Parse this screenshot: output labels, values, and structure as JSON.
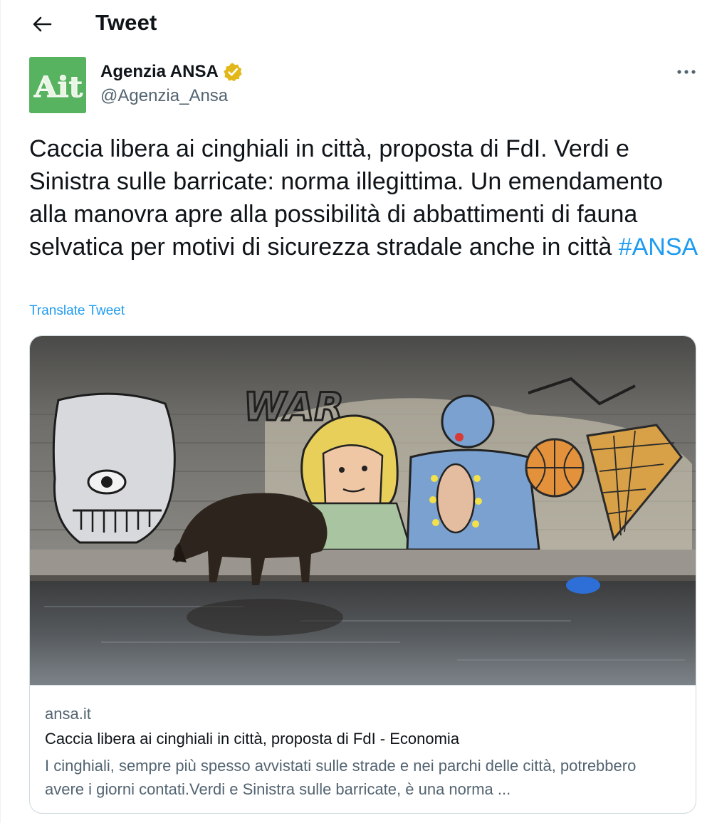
{
  "header": {
    "title": "Tweet"
  },
  "author": {
    "avatar_text": "Ait",
    "name": "Agenzia ANSA",
    "handle": "@Agenzia_Ansa"
  },
  "tweet": {
    "text": "Caccia libera ai cinghiali in città, proposta di  FdI. Verdi e Sinistra sulle barricate: norma illegittima. Un emendamento alla manovra apre alla possibilità di abbattimenti di fauna selvatica per motivi di sicurezza stradale anche in città",
    "hashtag": "#ANSA",
    "translate_label": "Translate Tweet"
  },
  "card": {
    "image_text": "WAR",
    "domain": "ansa.it",
    "title": "Caccia libera ai cinghiali in città, proposta di FdI - Economia",
    "description": "I cinghiali, sempre più spesso avvistati sulle strade e nei parchi delle città, potrebbero avere i giorni contati.Verdi e Sinistra sulle barricate, è una norma ..."
  },
  "colors": {
    "accent": "#1d9bf0",
    "avatar_bg": "#58b361",
    "verified": "#e2b719",
    "secondary_text": "#536471"
  }
}
